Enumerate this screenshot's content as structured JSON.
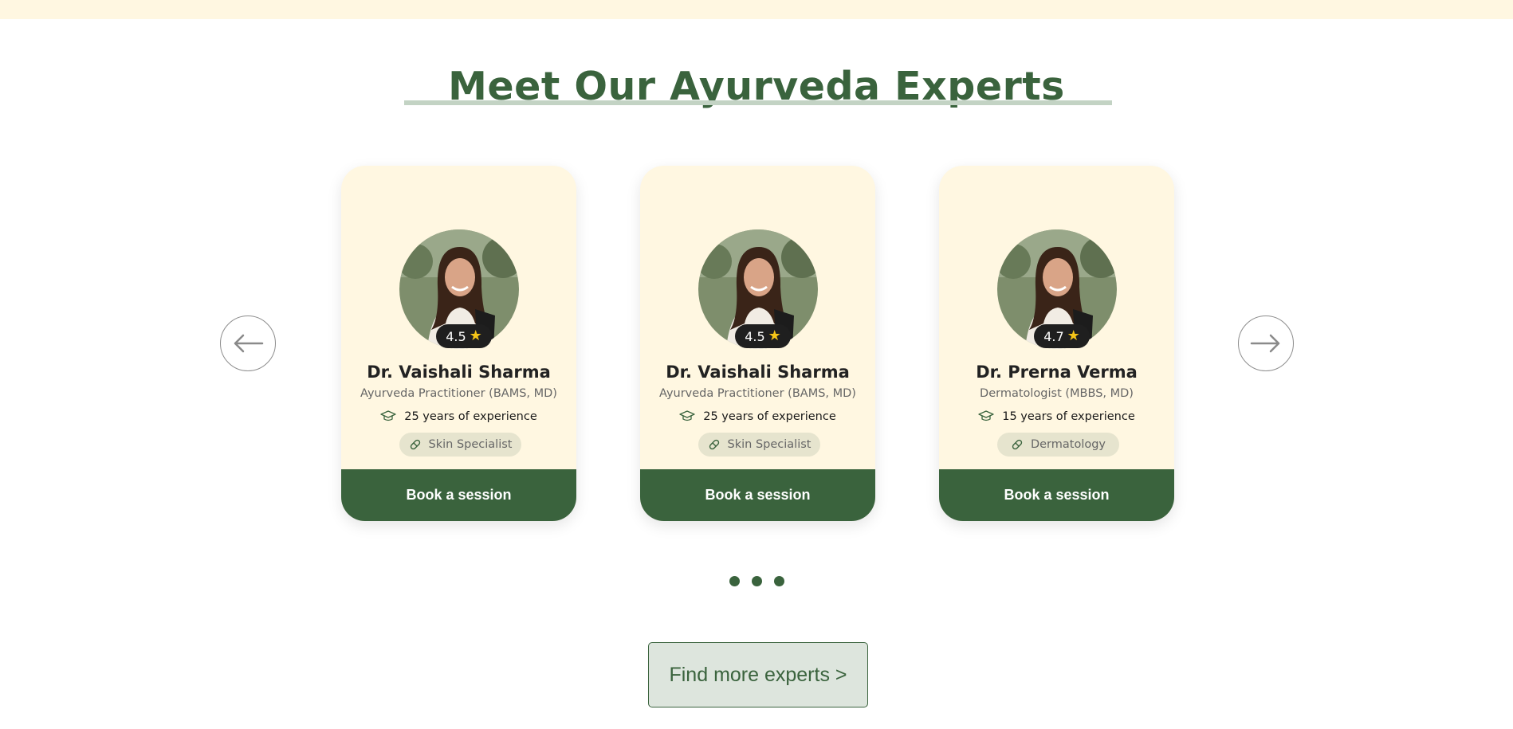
{
  "section": {
    "title": "Meet Our Ayurveda Experts"
  },
  "colors": {
    "brand_green": "#3a633d",
    "card_cream": "#fff7e1",
    "tag_bg": "#e6e4ce",
    "star": "#f5c518"
  },
  "carousel": {
    "prev_icon": "arrow-left-icon",
    "next_icon": "arrow-right-icon",
    "dots": 3
  },
  "experts": [
    {
      "name": "Dr. Vaishali Sharma",
      "qualification": "Ayurveda Practitioner (BAMS, MD)",
      "rating": "4.5",
      "experience": "25 years of experience",
      "specialty": "Skin Specialist",
      "cta": "Book a session"
    },
    {
      "name": "Dr. Vaishali Sharma",
      "qualification": "Ayurveda Practitioner (BAMS, MD)",
      "rating": "4.5",
      "experience": "25 years of experience",
      "specialty": "Skin Specialist",
      "cta": "Book a session"
    },
    {
      "name": "Dr. Prerna Verma",
      "qualification": "Dermatologist (MBBS, MD)",
      "rating": "4.7",
      "experience": "15 years of experience",
      "specialty": "Dermatology",
      "cta": "Book a session"
    }
  ],
  "find_more": {
    "label": "Find more experts >"
  }
}
